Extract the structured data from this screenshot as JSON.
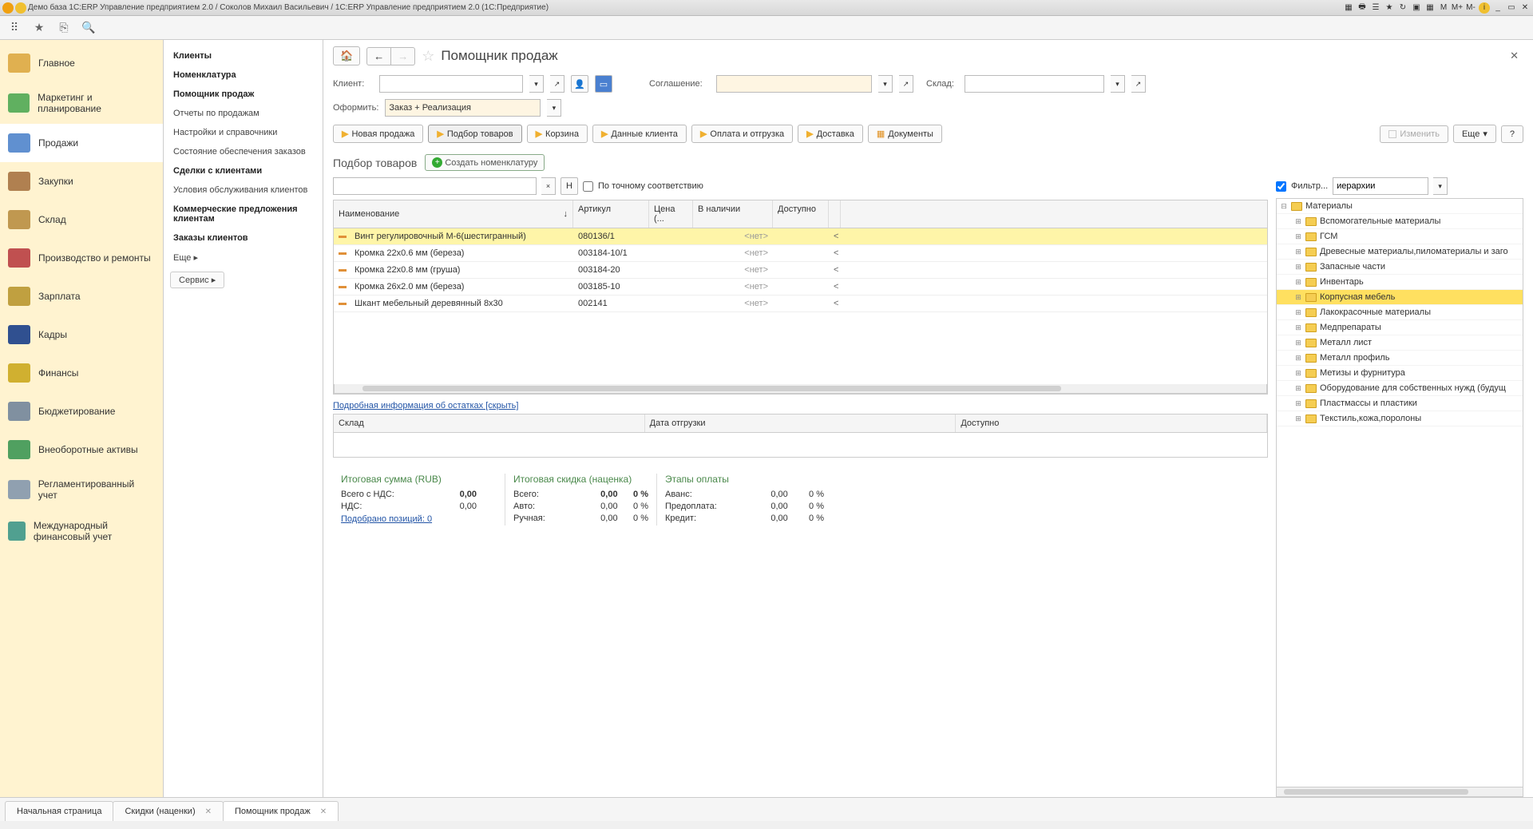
{
  "titlebar": "Демо база 1С:ERP Управление предприятием 2.0 / Соколов Михаил Васильевич / 1С:ERP Управление предприятием 2.0  (1С:Предприятие)",
  "tb_right": [
    "M",
    "M+",
    "M-"
  ],
  "nav1": [
    {
      "label": "Главное",
      "c": "#e0b050"
    },
    {
      "label": "Маркетинг и планирование",
      "c": "#60b060"
    },
    {
      "label": "Продажи",
      "c": "#6090d0",
      "active": true
    },
    {
      "label": "Закупки",
      "c": "#b08050"
    },
    {
      "label": "Склад",
      "c": "#c09850"
    },
    {
      "label": "Производство и ремонты",
      "c": "#c05050"
    },
    {
      "label": "Зарплата",
      "c": "#c0a040"
    },
    {
      "label": "Кадры",
      "c": "#305090"
    },
    {
      "label": "Финансы",
      "c": "#d0b030"
    },
    {
      "label": "Бюджетирование",
      "c": "#8090a0"
    },
    {
      "label": "Внеоборотные активы",
      "c": "#50a060"
    },
    {
      "label": "Регламентированный учет",
      "c": "#90a0b0"
    },
    {
      "label": "Международный финансовый учет",
      "c": "#50a090"
    }
  ],
  "nav2": [
    {
      "t": "Клиенты",
      "b": true
    },
    {
      "t": "Номенклатура",
      "b": true
    },
    {
      "t": "Помощник продаж",
      "b": true
    },
    {
      "t": "Отчеты по продажам"
    },
    {
      "t": "Настройки и справочники"
    },
    {
      "t": "Состояние обеспечения заказов"
    },
    {
      "t": "Сделки с клиентами",
      "b": true
    },
    {
      "t": "Условия обслуживания клиентов"
    },
    {
      "t": "Коммерческие предложения клиентам",
      "b": true
    },
    {
      "t": "Заказы клиентов",
      "b": true
    },
    {
      "t": "Еще ▸"
    }
  ],
  "nav2_service": "Сервис ▸",
  "page_title": "Помощник продаж",
  "labels": {
    "client": "Клиент:",
    "agree": "Соглашение:",
    "wh": "Склад:",
    "ofo": "Оформить:"
  },
  "ofo_val": "Заказ + Реализация",
  "wiz": [
    {
      "t": "Новая продажа",
      "arrow": true
    },
    {
      "t": "Подбор товаров",
      "active": true,
      "arrow": true
    },
    {
      "t": "Корзина",
      "arrow": true
    },
    {
      "t": "Данные клиента",
      "arrow": true
    },
    {
      "t": "Оплата и отгрузка",
      "arrow": true
    },
    {
      "t": "Доставка",
      "arrow": true
    },
    {
      "t": "Документы",
      "doc": true
    }
  ],
  "btn_change": "Изменить",
  "btn_more": "Еще",
  "btn_help": "?",
  "sect": "Подбор товаров",
  "btn_create": "Создать номенклатуру",
  "btn_n": "Н",
  "chk_exact": "По точному соответствию",
  "filter_lbl": "Фильтр...",
  "filter_val": "иерархии",
  "cols": {
    "name": "Наименование",
    "art": "Артикул",
    "price": "Цена (...",
    "stock": "В наличии",
    "avail": "Доступно"
  },
  "rows": [
    {
      "n": "Винт регулировочный М-6(шестигранный)",
      "a": "080136/1",
      "s": "<нет>",
      "sel": true
    },
    {
      "n": "Кромка 22х0.6 мм (береза)",
      "a": "003184-10/1",
      "s": "<нет>"
    },
    {
      "n": "Кромка 22х0.8 мм (груша)",
      "a": "003184-20",
      "s": "<нет>"
    },
    {
      "n": "Кромка 26х2.0 мм (береза)",
      "a": "003185-10",
      "s": "<нет>"
    },
    {
      "n": "Шкант мебельный деревянный 8х30",
      "a": "002141",
      "s": "<нет>"
    }
  ],
  "tree": [
    {
      "t": "Материалы",
      "lv": 0,
      "open": true
    },
    {
      "t": "Вспомогательные материалы",
      "lv": 1
    },
    {
      "t": "ГСМ",
      "lv": 1
    },
    {
      "t": "Древесные материалы,пиломатериалы и заго",
      "lv": 1
    },
    {
      "t": "Запасные части",
      "lv": 1
    },
    {
      "t": "Инвентарь",
      "lv": 1
    },
    {
      "t": "Корпусная мебель",
      "lv": 1,
      "sel": true
    },
    {
      "t": "Лакокрасочные материалы",
      "lv": 1
    },
    {
      "t": "Медпрепараты",
      "lv": 1
    },
    {
      "t": "Металл лист",
      "lv": 1
    },
    {
      "t": "Металл профиль",
      "lv": 1
    },
    {
      "t": "Метизы и фурнитура",
      "lv": 1
    },
    {
      "t": "Оборудование для собственных нужд (будущ",
      "lv": 1
    },
    {
      "t": "Пластмассы и пластики",
      "lv": 1
    },
    {
      "t": "Текстиль,кожа,поролоны",
      "lv": 1
    }
  ],
  "link_stock": "Подробная информация об остатках [скрыть]",
  "stock_cols": {
    "w": "Склад",
    "d": "Дата отгрузки",
    "a": "Доступно"
  },
  "totals": {
    "h1": "Итоговая сумма (RUB)",
    "h2": "Итоговая скидка (наценка)",
    "h3": "Этапы оплаты",
    "r1": [
      {
        "l": "Всего с НДС:",
        "v": "0,00",
        "b": true
      }
    ],
    "r1b": [
      {
        "l": "НДС:",
        "v": "0,00"
      }
    ],
    "r1link": "Подобрано позиций: 0",
    "r2": [
      {
        "l": "Всего:",
        "v": "0,00",
        "p": "0 %",
        "b": true
      },
      {
        "l": "Авто:",
        "v": "0,00",
        "p": "0 %"
      },
      {
        "l": "Ручная:",
        "v": "0,00",
        "p": "0 %"
      }
    ],
    "r3": [
      {
        "l": "Аванс:",
        "v": "0,00",
        "p": "0 %"
      },
      {
        "l": "Предоплата:",
        "v": "0,00",
        "p": "0 %"
      },
      {
        "l": "Кредит:",
        "v": "0,00",
        "p": "0 %"
      }
    ]
  },
  "tabs": [
    {
      "t": "Начальная страница"
    },
    {
      "t": "Скидки (наценки)",
      "x": true
    },
    {
      "t": "Помощник продаж",
      "x": true,
      "active": true
    }
  ]
}
